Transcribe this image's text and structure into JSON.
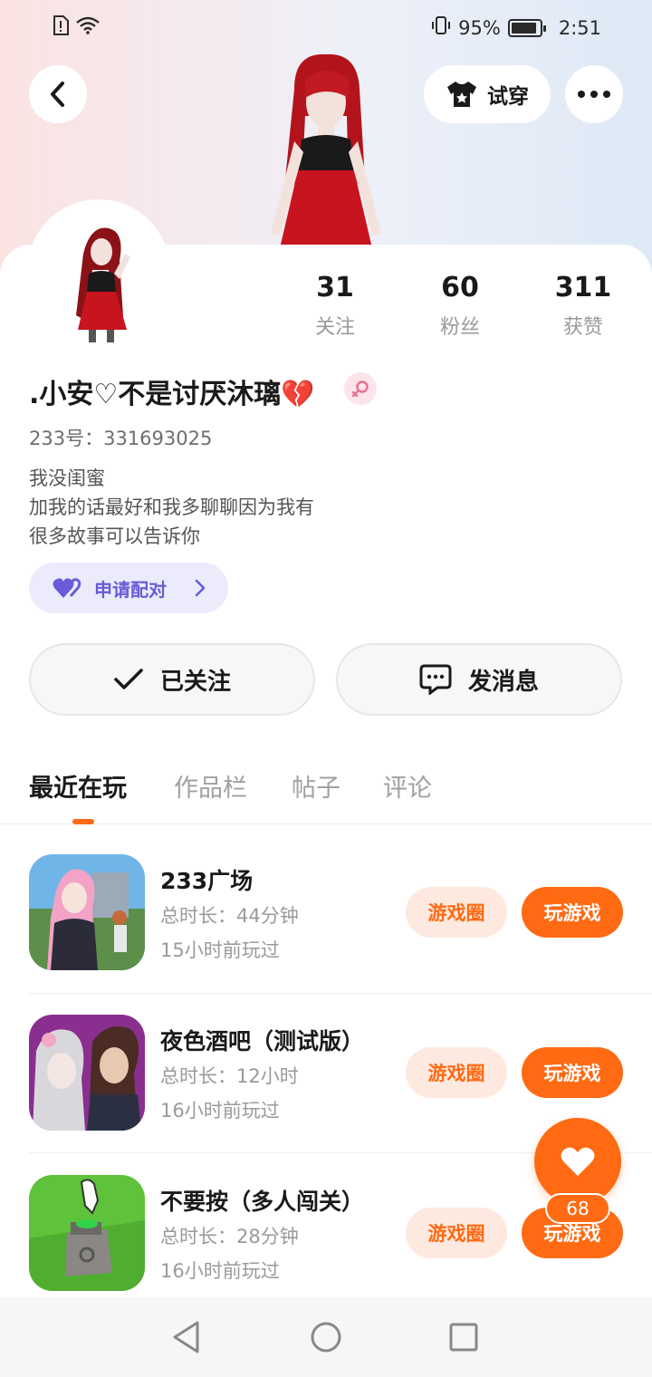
{
  "status_bar": {
    "battery": "95%",
    "time": "2:51"
  },
  "header": {
    "tryon_label": "试穿"
  },
  "profile": {
    "nickname": ".小安♡不是讨厌沐璃💔",
    "uid_label": "233号：331693025",
    "bio_lines": [
      "我没闺蜜",
      "加我的话最好和我多聊聊因为我有",
      "很多故事可以告诉你"
    ],
    "stats": [
      {
        "value": "31",
        "label": "关注"
      },
      {
        "value": "60",
        "label": "粉丝"
      },
      {
        "value": "311",
        "label": "获赞"
      }
    ],
    "pair_label": "申请配对",
    "follow_label": "已关注",
    "message_label": "发消息"
  },
  "tabs": [
    "最近在玩",
    "作品栏",
    "帖子",
    "评论"
  ],
  "games": [
    {
      "name": "233广场",
      "duration": "总时长：44分钟",
      "last_played": "15小时前玩过",
      "circle_label": "游戏圈",
      "play_label": "玩游戏"
    },
    {
      "name": "夜色酒吧（测试版）",
      "duration": "总时长：12小时",
      "last_played": "16小时前玩过",
      "circle_label": "游戏圈",
      "play_label": "玩游戏"
    },
    {
      "name": "不要按（多人闯关）",
      "duration": "总时长：28分钟",
      "last_played": "16小时前玩过",
      "circle_label": "游戏圈",
      "play_label": "玩游戏"
    }
  ],
  "fab": {
    "count": "68"
  },
  "colors": {
    "accent": "#ff6a13",
    "pair": "#6b5bd6"
  }
}
